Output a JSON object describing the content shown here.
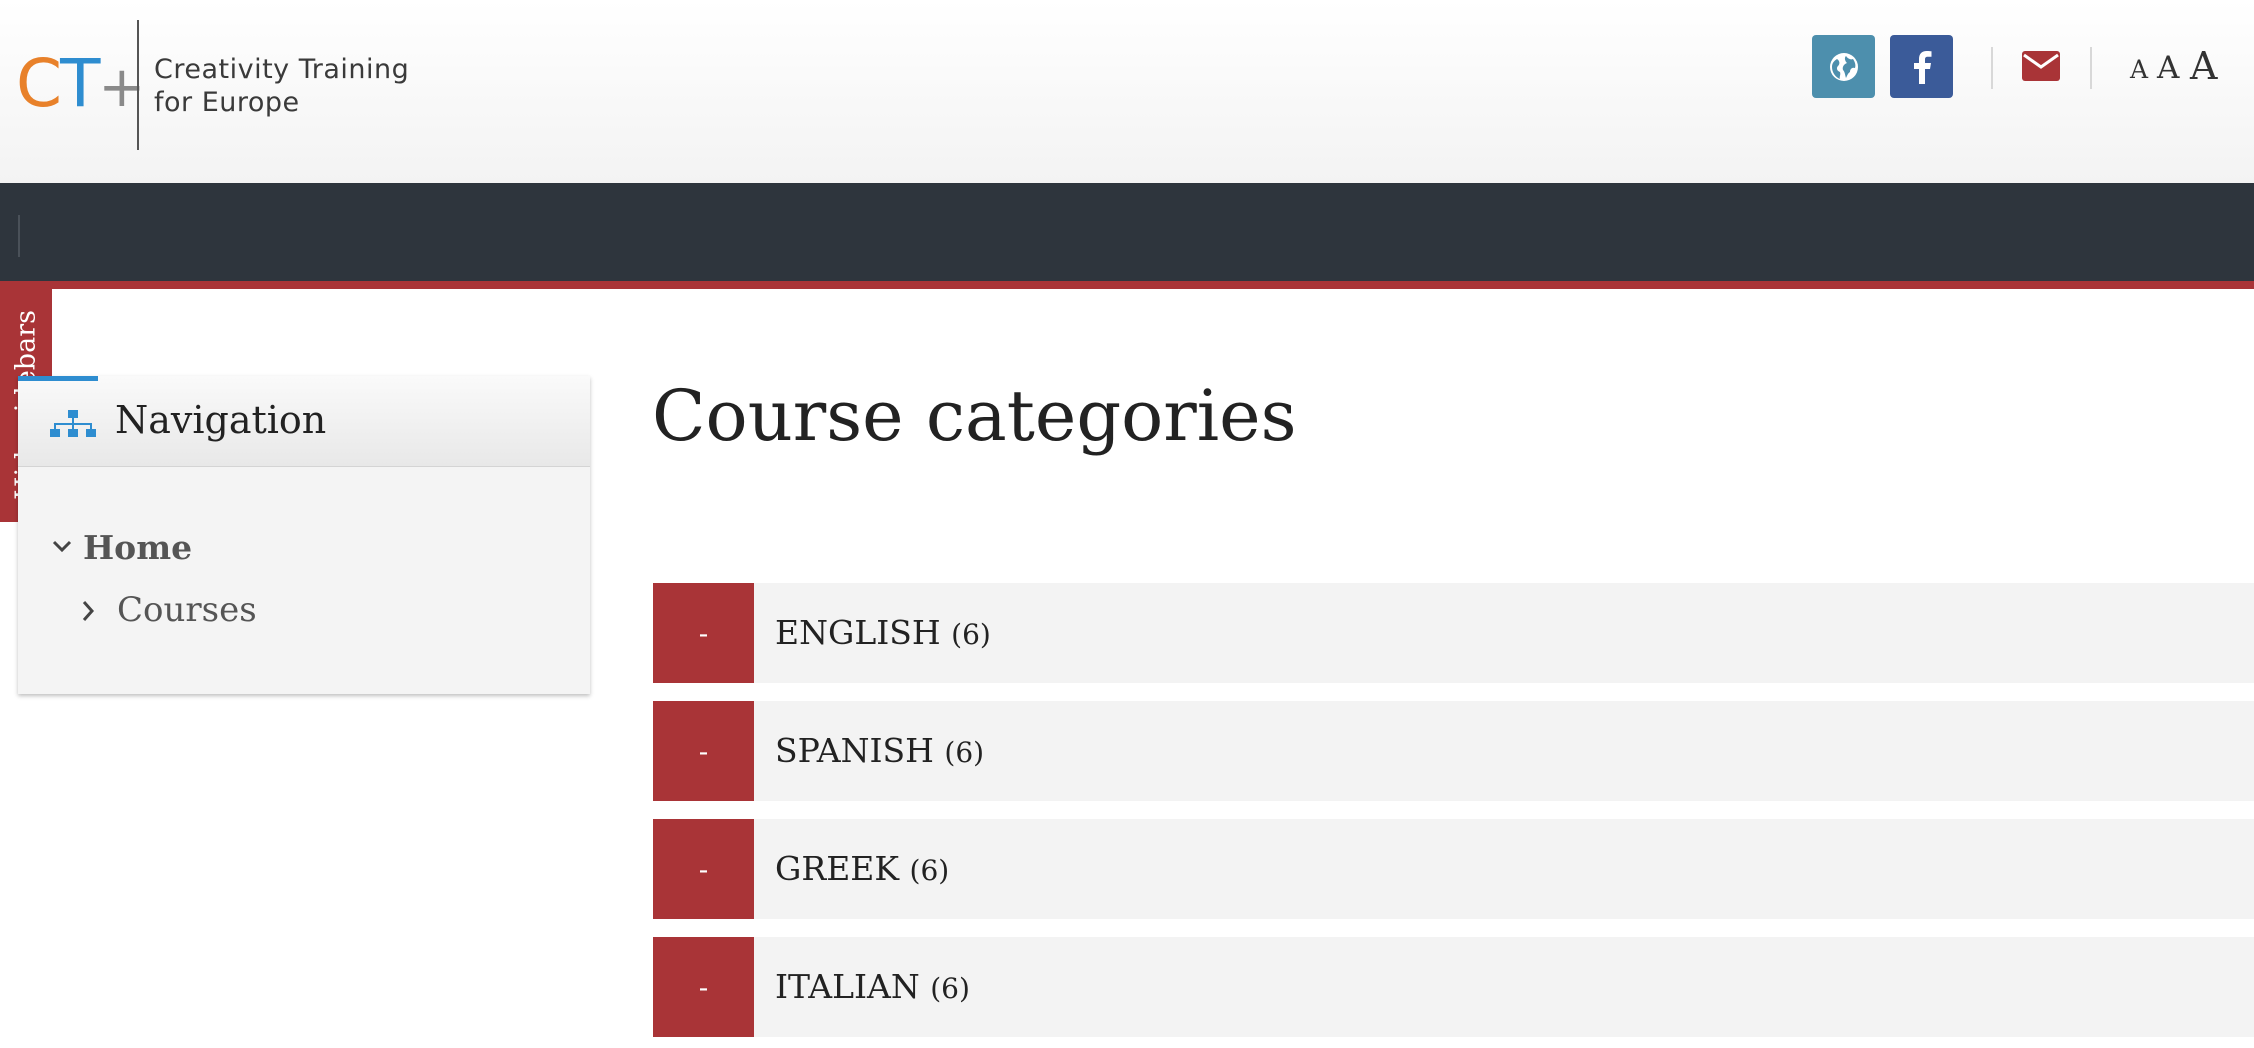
{
  "header": {
    "logo_text": "CT+",
    "logo_line1": "Creativity Training",
    "logo_line2": "for Europe",
    "icons": [
      "globe-icon",
      "facebook-icon",
      "mail-icon"
    ],
    "font_size_labels": [
      "A",
      "A",
      "A"
    ]
  },
  "sidebar_toggle": {
    "label": "Hide sidebars"
  },
  "navigation": {
    "title": "Navigation",
    "icon": "sitemap-icon",
    "items": [
      {
        "label": "Home",
        "expanded": true
      },
      {
        "label": "Courses",
        "expanded": false
      }
    ]
  },
  "main": {
    "title": "Course categories",
    "categories": [
      {
        "name": "ENGLISH",
        "count": "(6)",
        "toggle": "-"
      },
      {
        "name": "SPANISH",
        "count": "(6)",
        "toggle": "-"
      },
      {
        "name": "GREEK",
        "count": "(6)",
        "toggle": "-"
      },
      {
        "name": "ITALIAN",
        "count": "(6)",
        "toggle": "-"
      }
    ]
  },
  "colors": {
    "accent_red": "#a93437",
    "navbar_dark": "#2e353d",
    "globe_button": "#4d8fad",
    "facebook_button": "#3b5b99",
    "logo_orange": "#e8812a",
    "logo_blue": "#2e8dd0"
  }
}
